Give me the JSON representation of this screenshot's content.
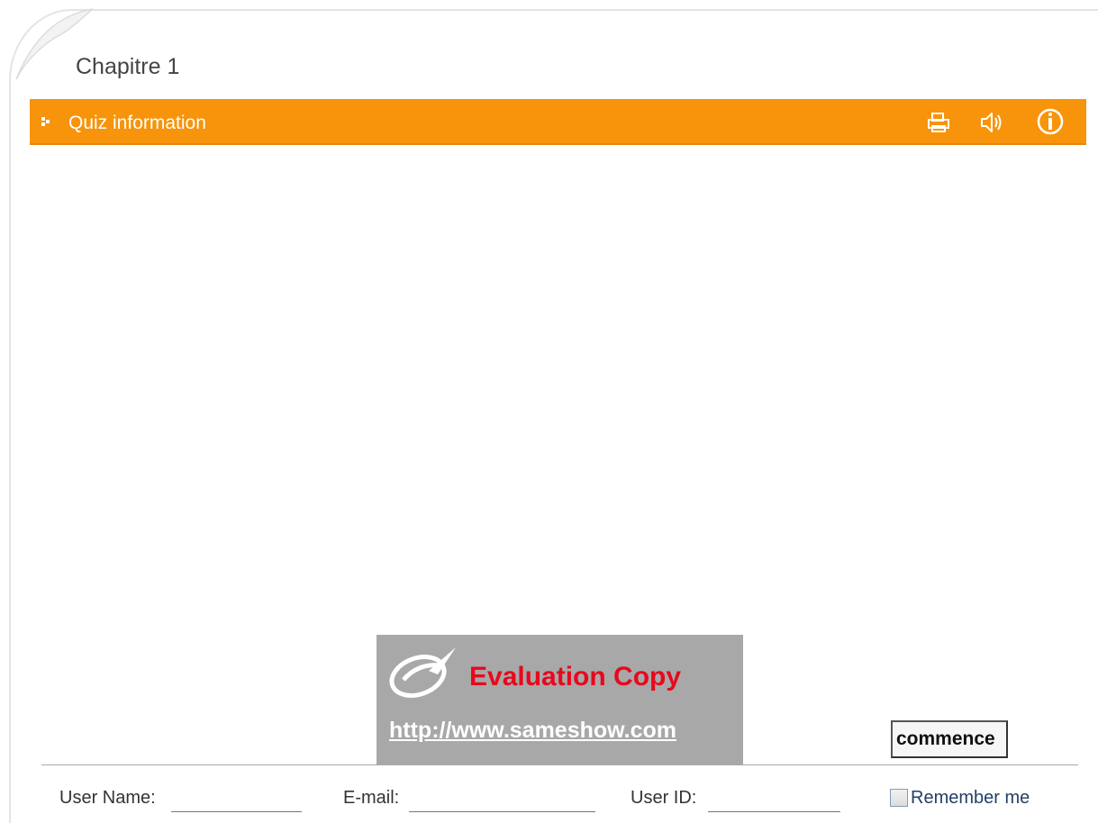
{
  "chapter": {
    "title": "Chapitre 1"
  },
  "quiz_bar": {
    "title": "Quiz information",
    "bar_color": "#f7940b",
    "icons": [
      "print-icon",
      "sound-icon",
      "info-icon"
    ]
  },
  "watermark": {
    "title": "Evaluation Copy",
    "url": "http://www.sameshow.com"
  },
  "actions": {
    "commence_label": "commence"
  },
  "login_form": {
    "user_name_label": "User Name:",
    "user_name_value": "",
    "email_label": "E-mail:",
    "email_value": "",
    "user_id_label": "User ID:",
    "user_id_value": "",
    "remember_label": "Remember me",
    "remember_checked": false
  }
}
